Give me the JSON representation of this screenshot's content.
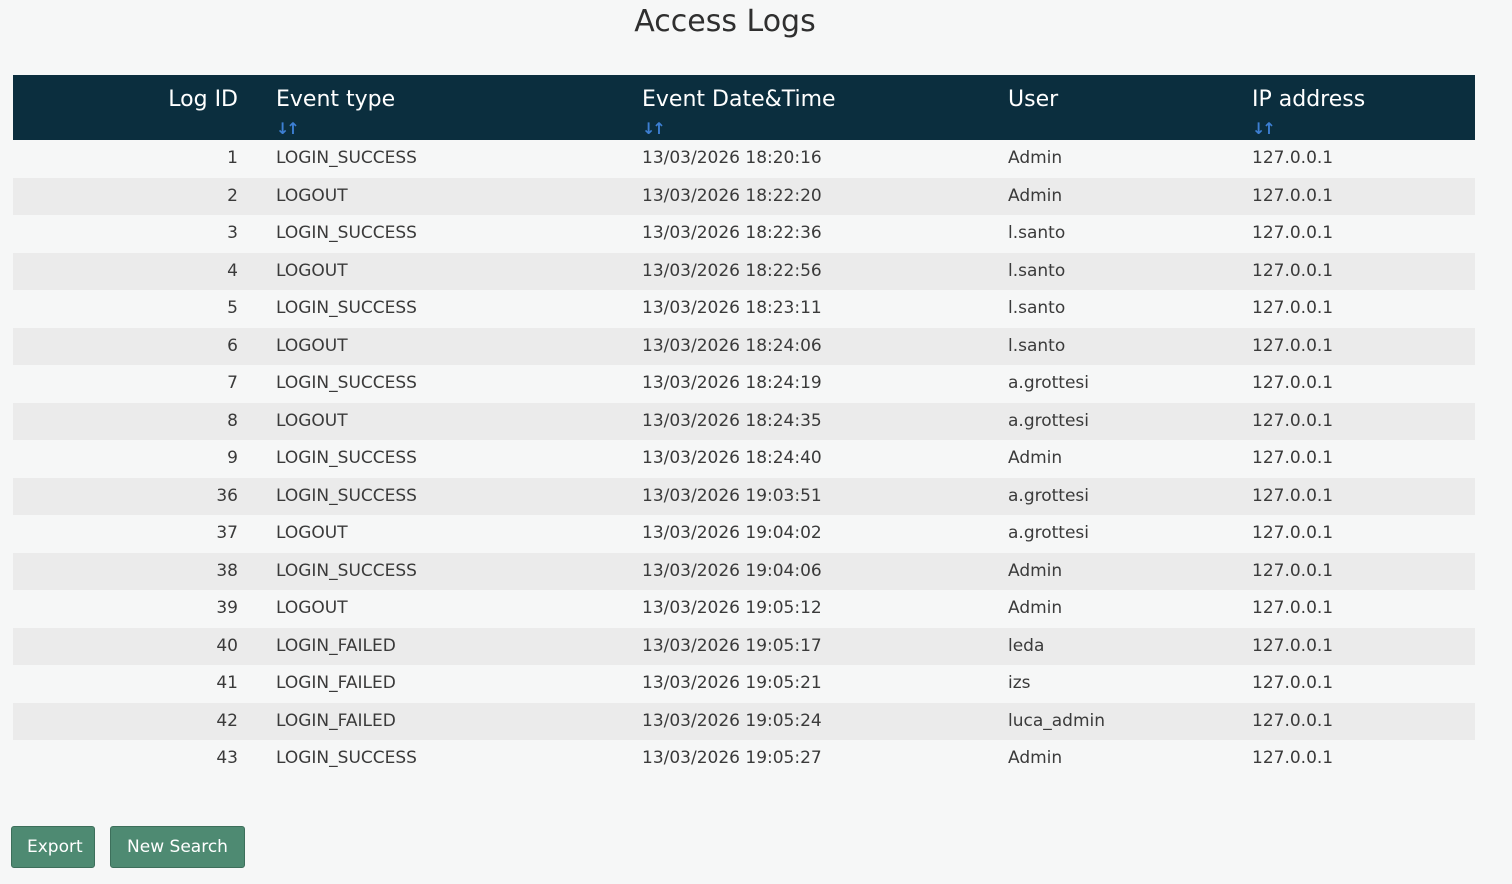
{
  "page": {
    "title": "Access Logs"
  },
  "table": {
    "columns": [
      {
        "key": "log_id",
        "label": "Log ID",
        "sortable": false
      },
      {
        "key": "event_type",
        "label": "Event type",
        "sortable": true
      },
      {
        "key": "event_datetime",
        "label": "Event Date&Time",
        "sortable": true
      },
      {
        "key": "user",
        "label": "User",
        "sortable": false
      },
      {
        "key": "ip_address",
        "label": "IP address",
        "sortable": true
      }
    ],
    "sort_icon": "sort-arrows-icon",
    "rows": [
      {
        "log_id": "1",
        "event_type": "LOGIN_SUCCESS",
        "event_datetime": "13/03/2026 18:20:16",
        "user": "Admin",
        "ip_address": "127.0.0.1"
      },
      {
        "log_id": "2",
        "event_type": "LOGOUT",
        "event_datetime": "13/03/2026 18:22:20",
        "user": "Admin",
        "ip_address": "127.0.0.1"
      },
      {
        "log_id": "3",
        "event_type": "LOGIN_SUCCESS",
        "event_datetime": "13/03/2026 18:22:36",
        "user": "l.santo",
        "ip_address": "127.0.0.1"
      },
      {
        "log_id": "4",
        "event_type": "LOGOUT",
        "event_datetime": "13/03/2026 18:22:56",
        "user": "l.santo",
        "ip_address": "127.0.0.1"
      },
      {
        "log_id": "5",
        "event_type": "LOGIN_SUCCESS",
        "event_datetime": "13/03/2026 18:23:11",
        "user": "l.santo",
        "ip_address": "127.0.0.1"
      },
      {
        "log_id": "6",
        "event_type": "LOGOUT",
        "event_datetime": "13/03/2026 18:24:06",
        "user": "l.santo",
        "ip_address": "127.0.0.1"
      },
      {
        "log_id": "7",
        "event_type": "LOGIN_SUCCESS",
        "event_datetime": "13/03/2026 18:24:19",
        "user": "a.grottesi",
        "ip_address": "127.0.0.1"
      },
      {
        "log_id": "8",
        "event_type": "LOGOUT",
        "event_datetime": "13/03/2026 18:24:35",
        "user": "a.grottesi",
        "ip_address": "127.0.0.1"
      },
      {
        "log_id": "9",
        "event_type": "LOGIN_SUCCESS",
        "event_datetime": "13/03/2026 18:24:40",
        "user": "Admin",
        "ip_address": "127.0.0.1"
      },
      {
        "log_id": "36",
        "event_type": "LOGIN_SUCCESS",
        "event_datetime": "13/03/2026 19:03:51",
        "user": "a.grottesi",
        "ip_address": "127.0.0.1"
      },
      {
        "log_id": "37",
        "event_type": "LOGOUT",
        "event_datetime": "13/03/2026 19:04:02",
        "user": "a.grottesi",
        "ip_address": "127.0.0.1"
      },
      {
        "log_id": "38",
        "event_type": "LOGIN_SUCCESS",
        "event_datetime": "13/03/2026 19:04:06",
        "user": "Admin",
        "ip_address": "127.0.0.1"
      },
      {
        "log_id": "39",
        "event_type": "LOGOUT",
        "event_datetime": "13/03/2026 19:05:12",
        "user": "Admin",
        "ip_address": "127.0.0.1"
      },
      {
        "log_id": "40",
        "event_type": "LOGIN_FAILED",
        "event_datetime": "13/03/2026 19:05:17",
        "user": "leda",
        "ip_address": "127.0.0.1"
      },
      {
        "log_id": "41",
        "event_type": "LOGIN_FAILED",
        "event_datetime": "13/03/2026 19:05:21",
        "user": "izs",
        "ip_address": "127.0.0.1"
      },
      {
        "log_id": "42",
        "event_type": "LOGIN_FAILED",
        "event_datetime": "13/03/2026 19:05:24",
        "user": "luca_admin",
        "ip_address": "127.0.0.1"
      },
      {
        "log_id": "43",
        "event_type": "LOGIN_SUCCESS",
        "event_datetime": "13/03/2026 19:05:27",
        "user": "Admin",
        "ip_address": "127.0.0.1"
      }
    ]
  },
  "actions": {
    "export_label": "Export",
    "new_search_label": "New Search"
  },
  "colors": {
    "header_bg": "#0b2e3e",
    "sort_icon": "#3d7fd3",
    "button_bg": "#4e8a72",
    "row_alt_bg": "#ebebeb"
  }
}
